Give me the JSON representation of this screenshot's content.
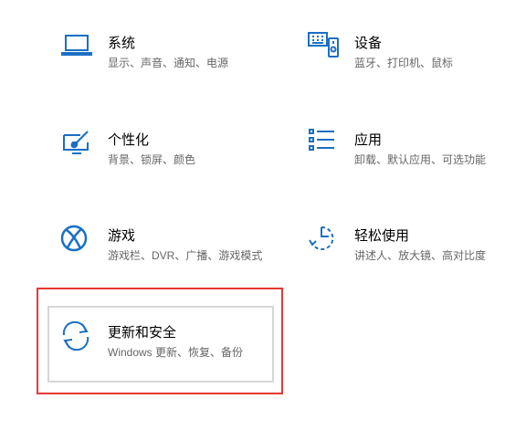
{
  "accent_color": "#1a6fc4",
  "highlight_color": "#e53935",
  "tiles": [
    {
      "title": "系统",
      "desc": "显示、声音、通知、电源",
      "icon": "laptop-icon"
    },
    {
      "title": "设备",
      "desc": "蓝牙、打印机、鼠标",
      "icon": "keyboard-icon"
    },
    {
      "title": "个性化",
      "desc": "背景、锁屏、颜色",
      "icon": "paint-icon"
    },
    {
      "title": "应用",
      "desc": "卸载、默认应用、可选功能",
      "icon": "apps-list-icon"
    },
    {
      "title": "游戏",
      "desc": "游戏栏、DVR、广播、游戏模式",
      "icon": "xbox-icon"
    },
    {
      "title": "轻松使用",
      "desc": "讲述人、放大镜、高对比度",
      "icon": "ease-of-access-icon"
    },
    {
      "title": "更新和安全",
      "desc": "Windows 更新、恢复、备份",
      "icon": "sync-icon"
    }
  ]
}
